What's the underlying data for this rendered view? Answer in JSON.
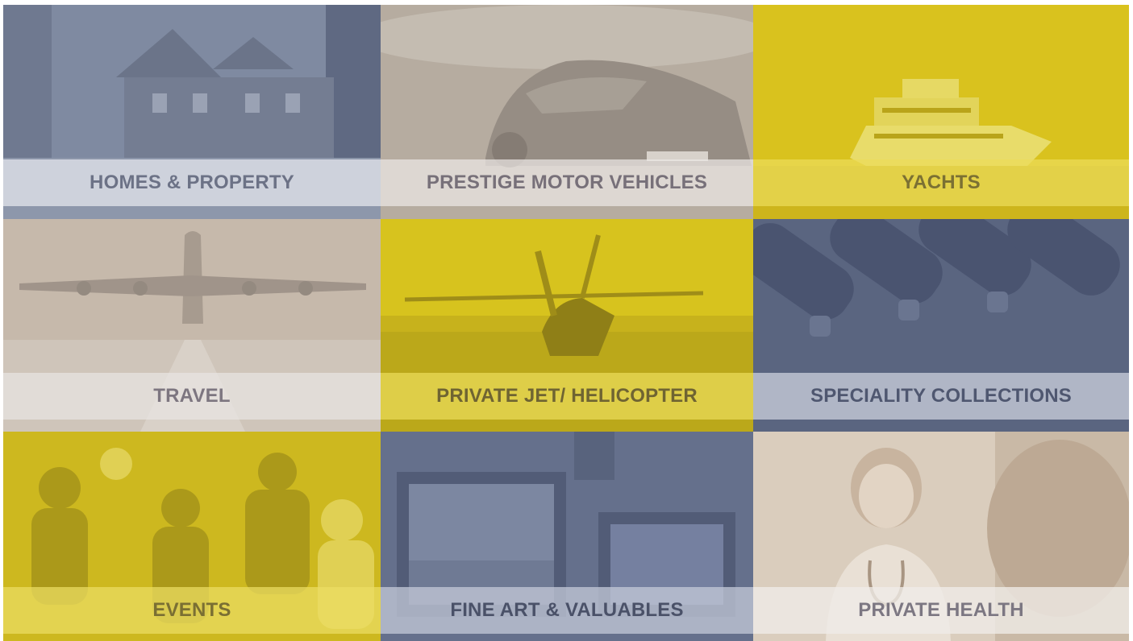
{
  "tiles": [
    {
      "label": "HOMES & PROPERTY",
      "color": "#7f8aa1",
      "band": "rgba(228,230,236,0.75)",
      "text": "#6c7286"
    },
    {
      "label": "PRESTIGE MOTOR VEHICLES",
      "color": "#b6aca0",
      "band": "rgba(236,232,228,0.72)",
      "text": "#777079"
    },
    {
      "label": "YACHTS",
      "color": "#d9c21e",
      "band": "rgba(236,220,90,0.72)",
      "text": "#7b7033"
    },
    {
      "label": "TRAVEL",
      "color": "#c6b9ab",
      "band": "rgba(232,228,226,0.72)",
      "text": "#7d7680"
    },
    {
      "label": "PRIVATE JET/ HELICOPTER",
      "color": "#d7c31e",
      "band": "rgba(236,220,90,0.72)",
      "text": "#6f6432"
    },
    {
      "label": "SPECIALITY COLLECTIONS",
      "color": "#5a6580",
      "band": "rgba(200,205,218,0.78)",
      "text": "#4f5770"
    },
    {
      "label": "EVENTS",
      "color": "#cdb81f",
      "band": "rgba(236,222,100,0.72)",
      "text": "#7a6f33"
    },
    {
      "label": "FINE ART & VALUABLES",
      "color": "#65708c",
      "band": "rgba(196,202,216,0.75)",
      "text": "#4a5168"
    },
    {
      "label": "PRIVATE HEALTH",
      "color": "#dacdbd",
      "band": "rgba(240,236,232,0.78)",
      "text": "#7c7782"
    }
  ]
}
